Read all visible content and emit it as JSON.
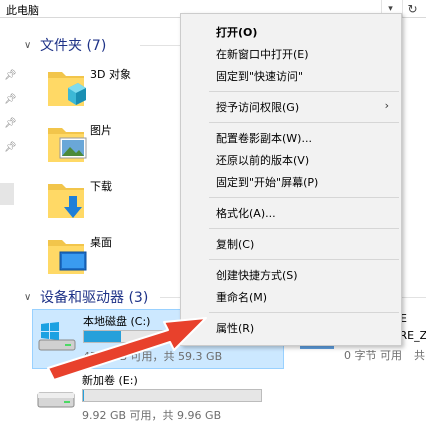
{
  "address_bar": {
    "path": "此电脑",
    "dropdown_icon": "chevron-down-icon",
    "refresh_icon": "refresh-icon"
  },
  "sections": {
    "folders": {
      "title": "文件夹 (7)"
    },
    "devices": {
      "title": "设备和驱动器 (3)"
    }
  },
  "folders": [
    {
      "label": "3D 对象",
      "icon": "3d-objects-folder-icon"
    },
    {
      "label": "图片",
      "icon": "pictures-folder-icon"
    },
    {
      "label": "下载",
      "icon": "downloads-folder-icon"
    },
    {
      "label": "桌面",
      "icon": "desktop-folder-icon"
    }
  ],
  "drives": [
    {
      "name": "本地磁盘 (C:)",
      "space": "47.0 GB 可用，共 59.3 GB",
      "used_fraction": 0.21,
      "selected": true
    },
    {
      "name": "新加卷 (E:)",
      "space": "9.92 GB 可用，共 9.96 GB",
      "used_fraction": 0.004,
      "selected": false
    }
  ],
  "partial_right": {
    "line1": "E",
    "line2": "_RE_Z",
    "space": "0 字节 可用",
    "space2": "共"
  },
  "context_menu": {
    "items": [
      "打开(O)",
      "在新窗口中打开(E)",
      "固定到\"快速访问\"",
      "授予访问权限(G)",
      "配置卷影副本(W)...",
      "还原以前的版本(V)",
      "固定到\"开始\"屏幕(P)",
      "格式化(A)...",
      "复制(C)",
      "创建快捷方式(S)",
      "重命名(M)",
      "属性(R)"
    ]
  },
  "colors": {
    "section_title": "#1e3287",
    "selection_bg": "#cce8ff",
    "drive_bar": "#26a0da",
    "arrow": "#e8412c",
    "menu_bg": "#f2f2f2"
  }
}
